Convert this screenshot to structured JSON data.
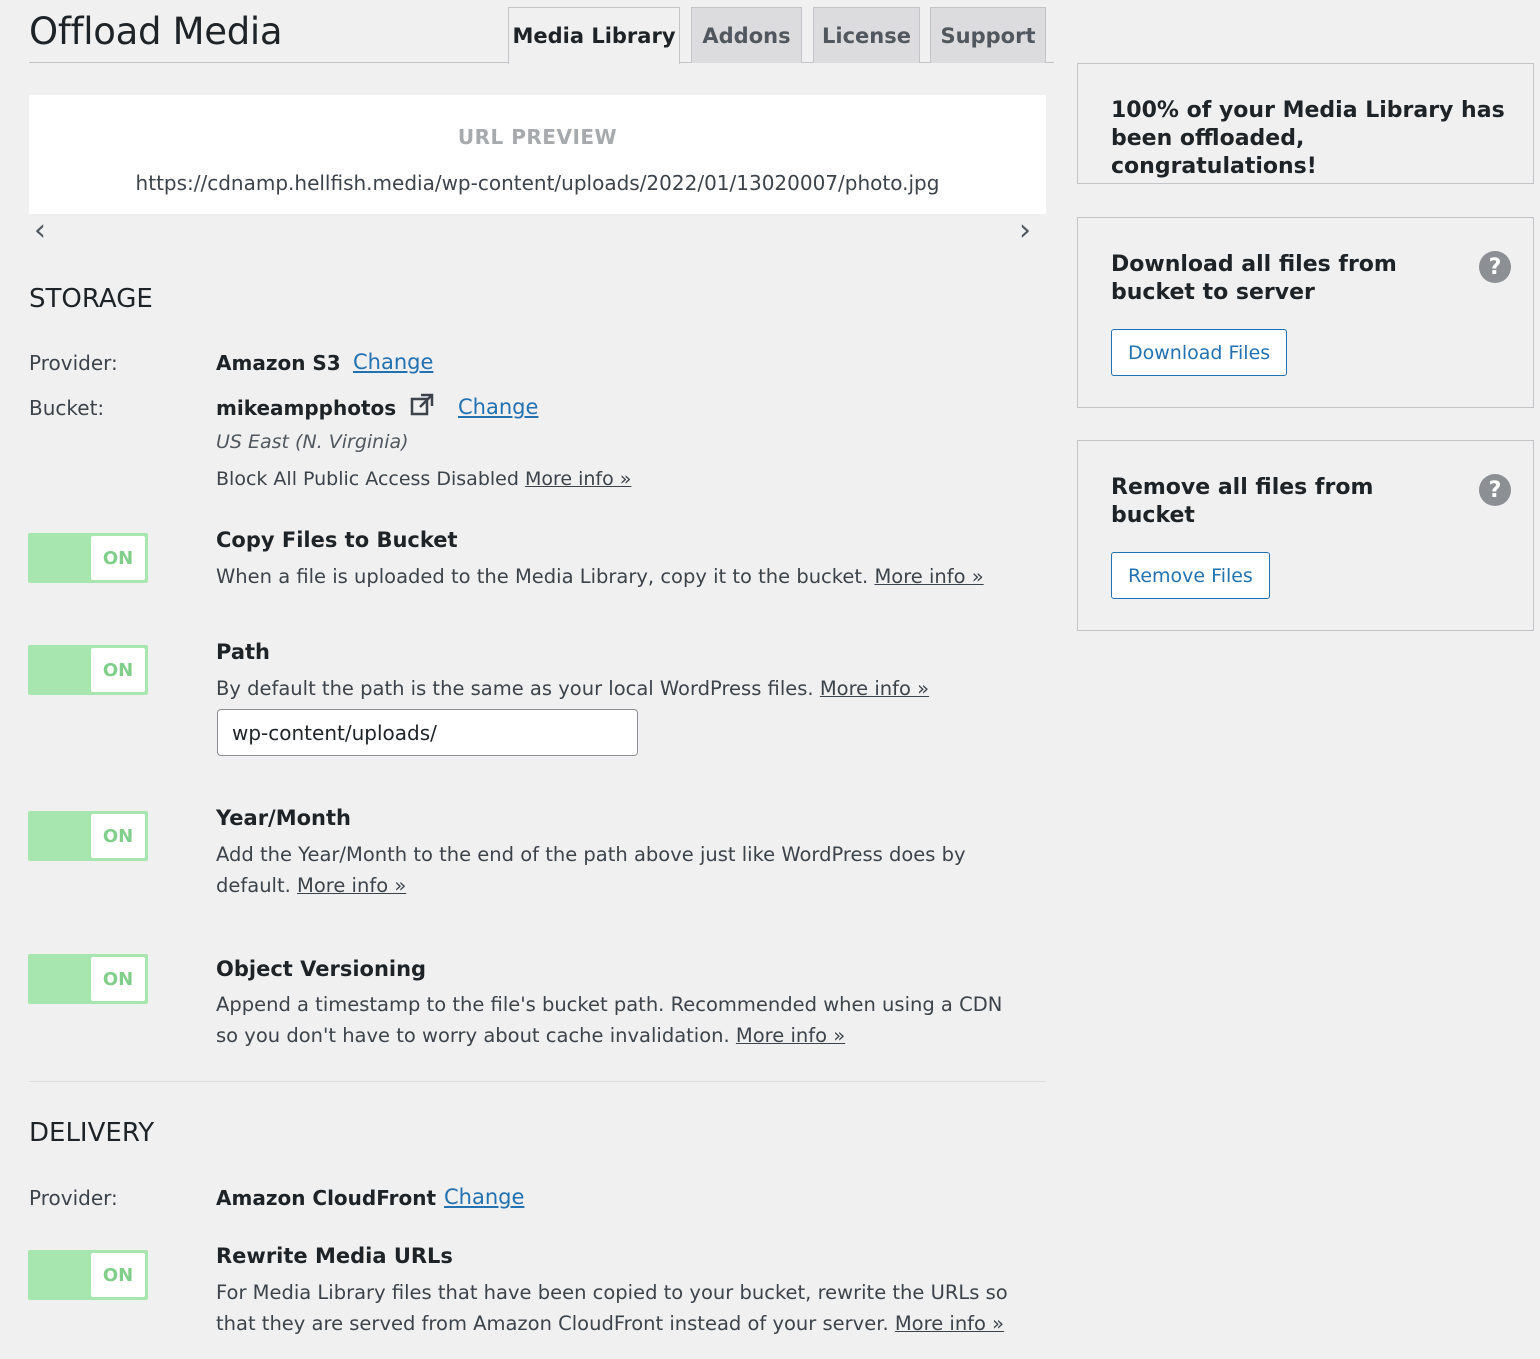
{
  "page": {
    "title": "Offload Media"
  },
  "tabs": [
    {
      "label": "Media Library",
      "active": true
    },
    {
      "label": "Addons"
    },
    {
      "label": "License"
    },
    {
      "label": "Support"
    }
  ],
  "preview": {
    "label": "URL PREVIEW",
    "url": "https://cdnamp.hellfish.media/wp-content/uploads/2022/01/13020007/photo.jpg",
    "prev_arrow": "‹",
    "next_arrow": "›"
  },
  "storage": {
    "heading": "STORAGE",
    "provider_label": "Provider:",
    "provider_value": "Amazon S3",
    "provider_change": "Change",
    "bucket_label": "Bucket:",
    "bucket_value": "mikeampphotos",
    "bucket_change": "Change",
    "region": "US East (N. Virginia)",
    "public_access": "Block All Public Access Disabled",
    "more_info": "More info »"
  },
  "settings": [
    {
      "toggle": "ON",
      "title": "Copy Files to Bucket",
      "desc": "When a file is uploaded to the Media Library, copy it to the bucket.",
      "more_info": "More info »"
    },
    {
      "toggle": "ON",
      "title": "Path",
      "desc": "By default the path is the same as your local WordPress files.",
      "more_info": "More info »",
      "input_value": "wp-content/uploads/"
    },
    {
      "toggle": "ON",
      "title": "Year/Month",
      "desc": "Add the Year/Month to the end of the path above just like WordPress does by default.",
      "more_info": "More info »"
    },
    {
      "toggle": "ON",
      "title": "Object Versioning",
      "desc": "Append a timestamp to the file's bucket path. Recommended when using a CDN so you don't have to worry about cache invalidation.",
      "more_info": "More info »"
    }
  ],
  "delivery": {
    "heading": "DELIVERY",
    "provider_label": "Provider:",
    "provider_value": "Amazon CloudFront",
    "provider_change": "Change",
    "rewrite": {
      "toggle": "ON",
      "title": "Rewrite Media URLs",
      "desc": "For Media Library files that have been copied to your bucket, rewrite the URLs so that they are served from Amazon CloudFront instead of your server.",
      "more_info": "More info »"
    }
  },
  "sidebar": {
    "status": "100% of your Media Library has been offloaded, congratulations!",
    "download": {
      "text": "Download all files from bucket to server",
      "button": "Download Files",
      "help": "?"
    },
    "remove": {
      "text": "Remove all files from bucket",
      "button": "Remove Files",
      "help": "?"
    }
  },
  "colors": {
    "accent": "#2271b1",
    "toggle_on": "#a8e6b0",
    "background": "#f0f0f1"
  }
}
